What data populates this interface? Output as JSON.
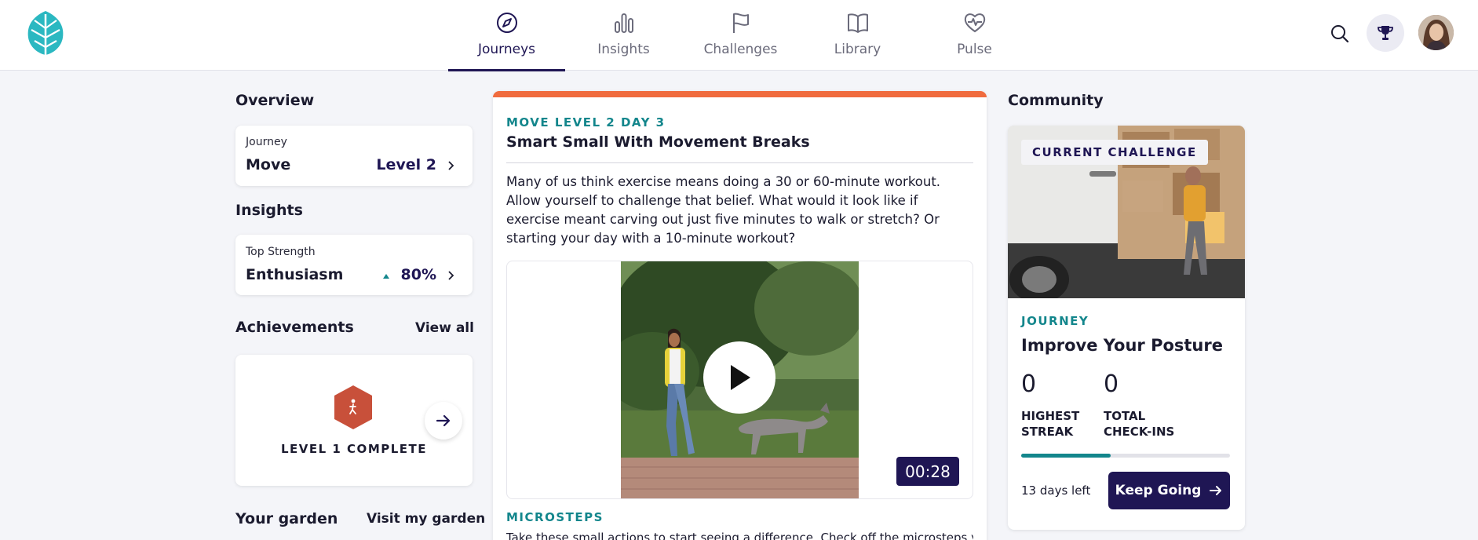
{
  "nav": {
    "items": [
      {
        "label": "Journeys",
        "icon": "compass-icon",
        "active": true
      },
      {
        "label": "Insights",
        "icon": "bar-chart-icon",
        "active": false
      },
      {
        "label": "Challenges",
        "icon": "flag-icon",
        "active": false
      },
      {
        "label": "Library",
        "icon": "book-icon",
        "active": false
      },
      {
        "label": "Pulse",
        "icon": "heartbeat-icon",
        "active": false
      }
    ],
    "accent": "#1f1654"
  },
  "left": {
    "overview_title": "Overview",
    "journey": {
      "caption": "Journey",
      "name": "Move",
      "level": "Level 2"
    },
    "insights_title": "Insights",
    "insight": {
      "caption": "Top Strength",
      "name": "Enthusiasm",
      "value": "80%"
    },
    "achievements_title": "Achievements",
    "view_all": "View all",
    "achievement_label": "LEVEL 1 COMPLETE",
    "garden_title": "Your garden",
    "visit_garden": "Visit my garden"
  },
  "middle": {
    "kicker": "MOVE LEVEL 2 DAY 3",
    "title": "Smart Small With Movement Breaks",
    "body": "Many of us think exercise means doing a 30 or 60-minute workout. Allow yourself to challenge that belief. What would it look like if exercise meant carving out just five minutes to walk or stretch? Or starting your day with a 10-minute workout?",
    "video_duration": "00:28",
    "microsteps_title": "MICROSTEPS",
    "microsteps_text": "Take these small actions to start seeing a difference. Check off the microsteps you",
    "accent_bar": "#f06b3e"
  },
  "right": {
    "title": "Community",
    "badge": "CURRENT CHALLENGE",
    "kicker": "JOURNEY",
    "name": "Improve Your Posture",
    "stats": [
      {
        "value": "0",
        "label_line1": "HIGHEST",
        "label_line2": "STREAK"
      },
      {
        "value": "0",
        "label_line1": "TOTAL",
        "label_line2": "CHECK-INS"
      }
    ],
    "progress_fraction": 0.43,
    "days_left": "13 days left",
    "button": "Keep Going",
    "teal": "#13868c"
  }
}
